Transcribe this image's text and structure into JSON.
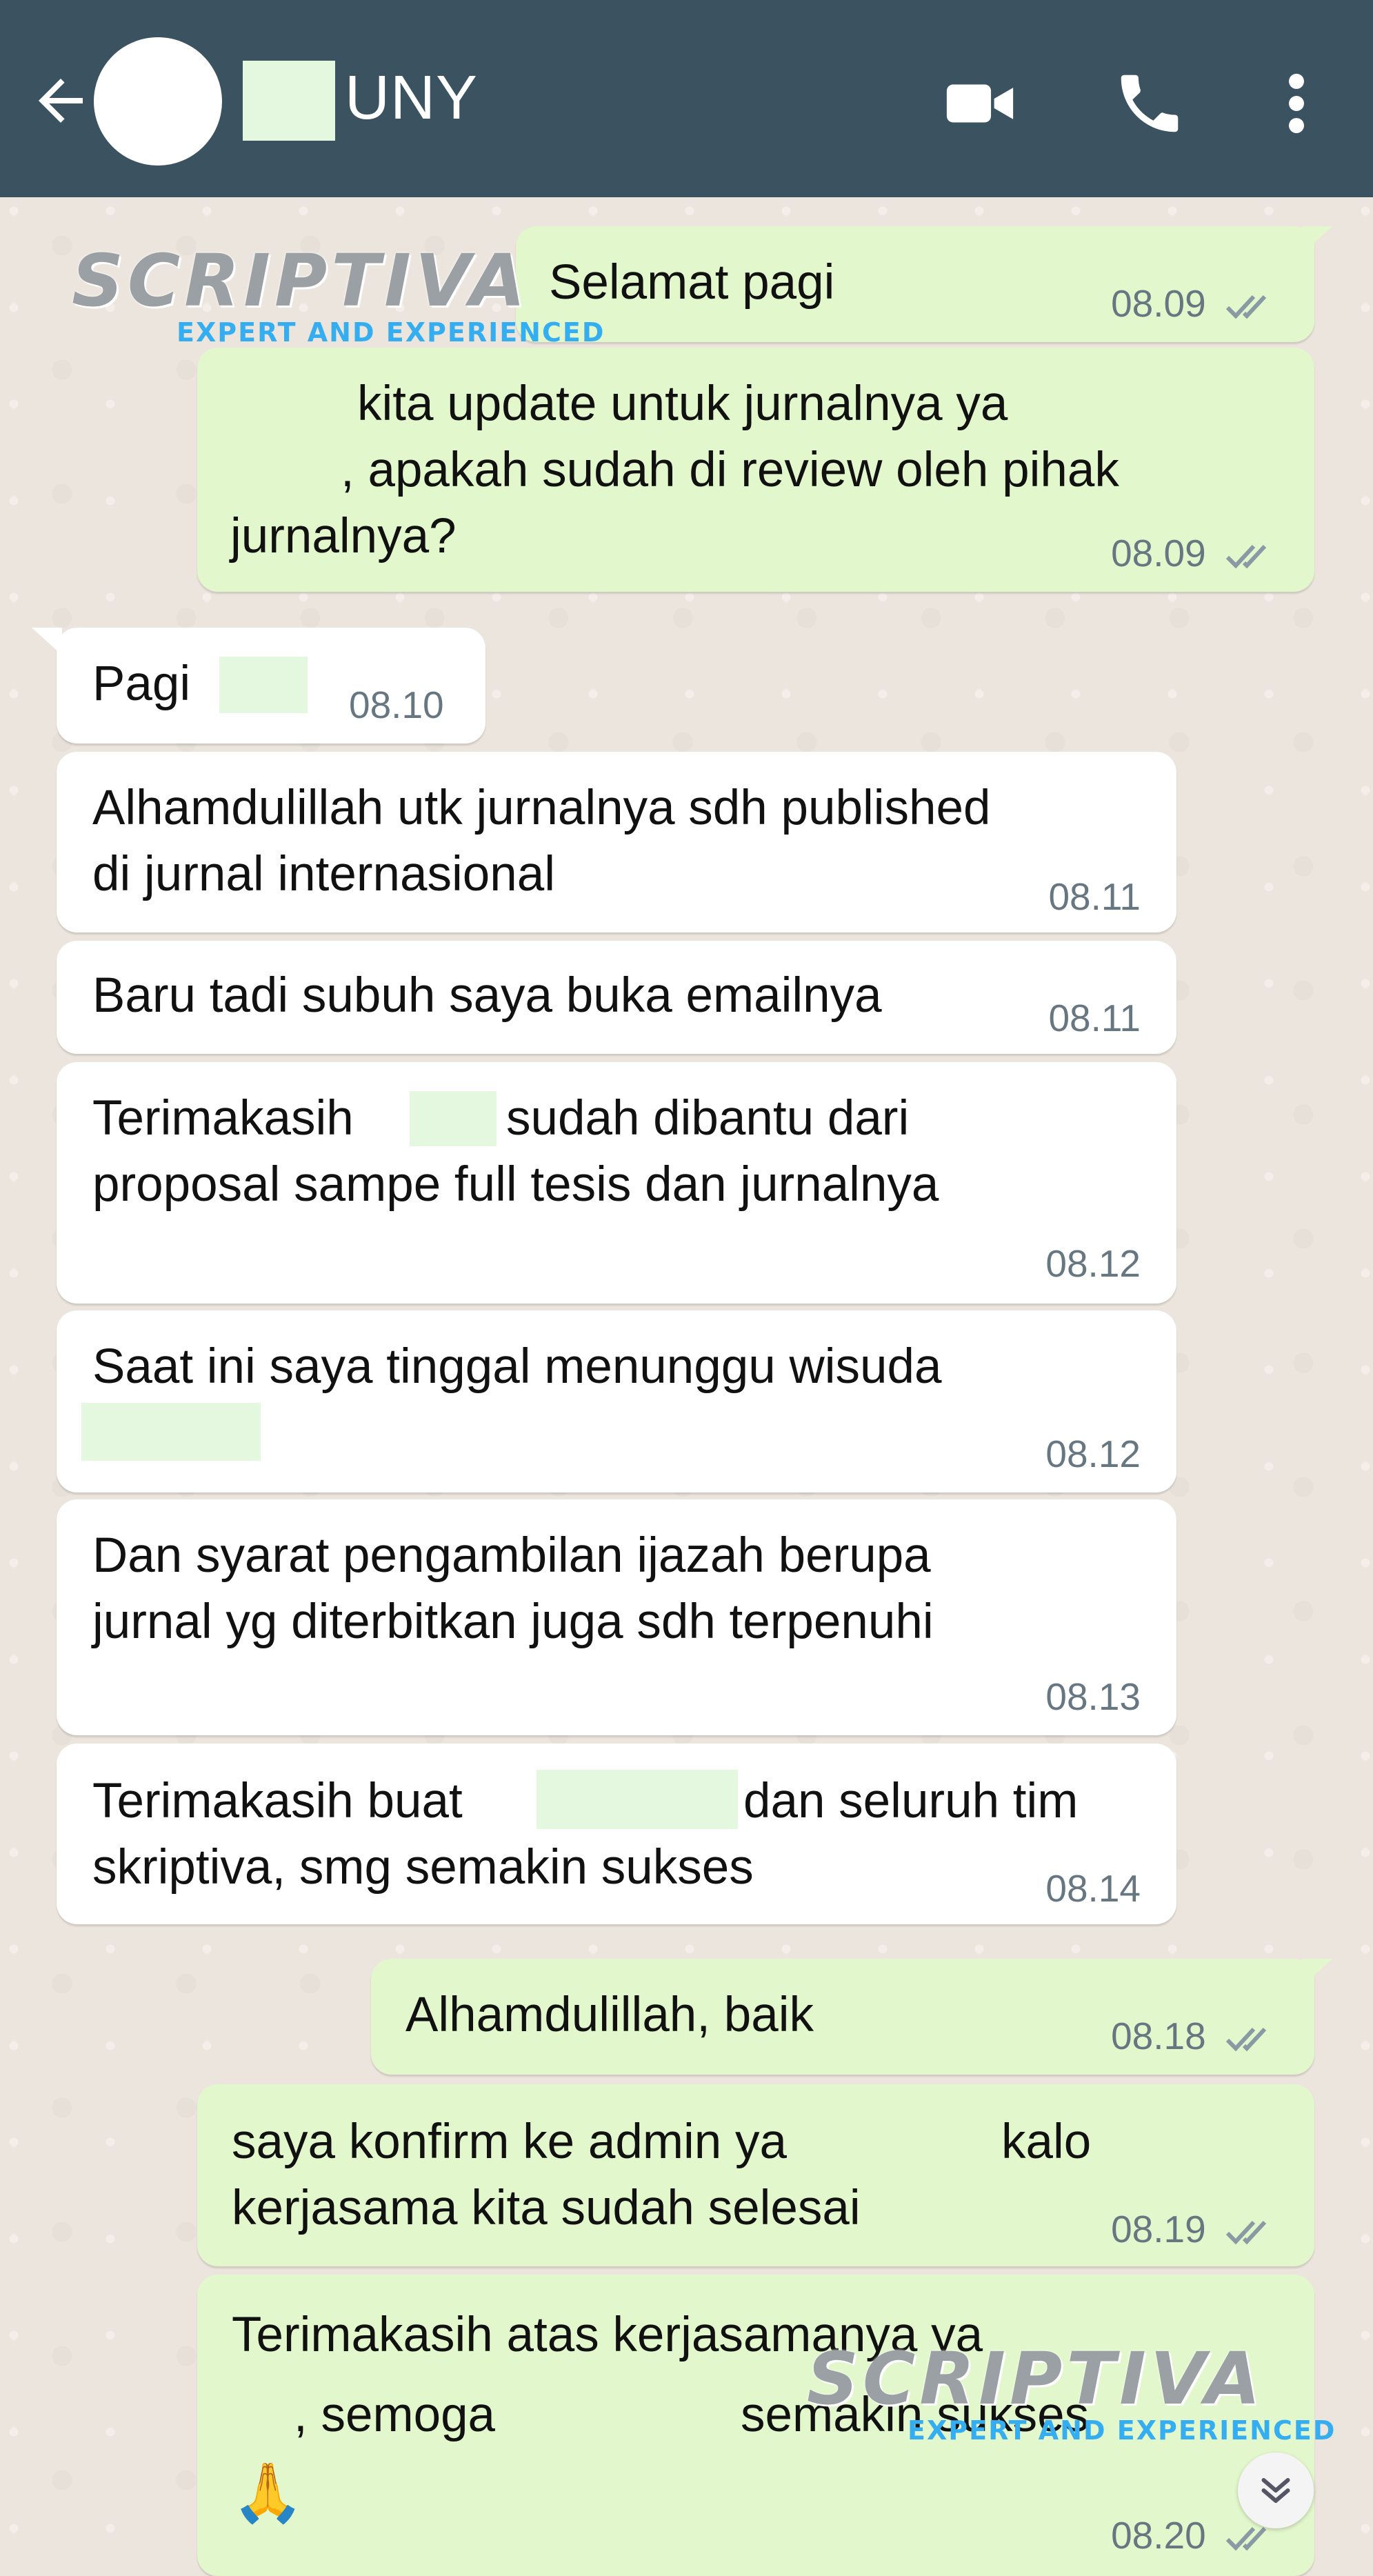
{
  "header": {
    "contact_name": "UNY",
    "icons": [
      "back-arrow-icon",
      "video-call-icon",
      "phone-icon",
      "more-vert-icon"
    ]
  },
  "watermark": {
    "brand": "SCRIPTIVA",
    "tagline": "EXPERT AND EXPERIENCED"
  },
  "messages": [
    {
      "dir": "out",
      "lines": [
        "Selamat pagi"
      ],
      "time": "08.09",
      "status": "read"
    },
    {
      "dir": "out",
      "lines": [
        "kita update untuk jurnalnya ya",
        ", apakah sudah di review oleh pihak",
        "jurnalnya?"
      ],
      "time": "08.09",
      "status": "read"
    },
    {
      "dir": "in",
      "lines": [
        "Pagi"
      ],
      "time": "08.10"
    },
    {
      "dir": "in",
      "lines": [
        "Alhamdulillah utk jurnalnya sdh published",
        "di jurnal internasional"
      ],
      "time": "08.11"
    },
    {
      "dir": "in",
      "lines": [
        "Baru tadi subuh saya buka emailnya"
      ],
      "time": "08.11"
    },
    {
      "dir": "in",
      "lines": [
        "Terimakasih",
        "sudah dibantu dari",
        "proposal sampe full tesis dan jurnalnya"
      ],
      "time": "08.12"
    },
    {
      "dir": "in",
      "lines": [
        "Saat ini saya tinggal menunggu wisuda"
      ],
      "time": "08.12"
    },
    {
      "dir": "in",
      "lines": [
        "Dan syarat pengambilan ijazah berupa",
        "jurnal yg diterbitkan juga sdh terpenuhi"
      ],
      "time": "08.13"
    },
    {
      "dir": "in",
      "lines": [
        "Terimakasih buat",
        "dan seluruh tim",
        "skriptiva, smg semakin sukses"
      ],
      "time": "08.14"
    },
    {
      "dir": "out",
      "lines": [
        "Alhamdulillah, baik"
      ],
      "time": "08.18",
      "status": "read"
    },
    {
      "dir": "out",
      "lines": [
        "saya konfirm ke admin ya",
        "kalo",
        "kerjasama kita sudah selesai"
      ],
      "time": "08.19",
      "status": "read"
    },
    {
      "dir": "out",
      "lines": [
        "Terimakasih atas kerjasamanya ya",
        ", semoga",
        "semakin sukses",
        "🙏"
      ],
      "time": "08.20",
      "status": "read"
    }
  ],
  "colors": {
    "header": "#3b5360",
    "outgoing": "#e2f7cb",
    "incoming": "#ffffff",
    "background": "#ece5dd",
    "tick": "#8a9aa4",
    "watermark_accent": "#34aef0"
  }
}
